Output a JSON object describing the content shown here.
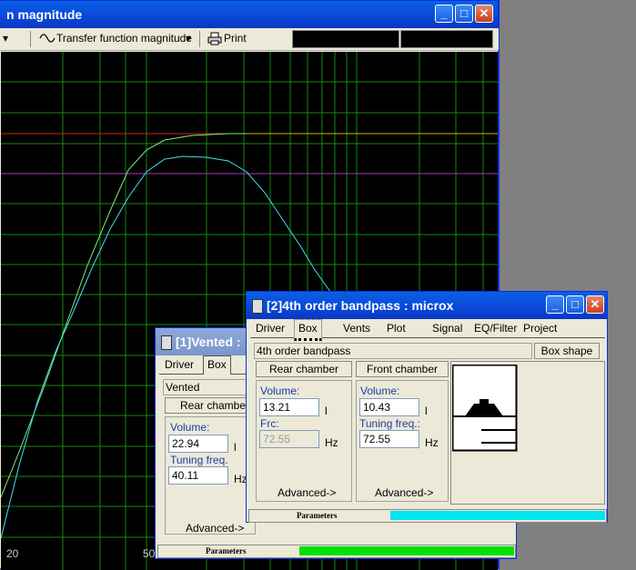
{
  "back_window": {
    "title": "n magnitude",
    "toolbar": {
      "dropdown_arrow": "▾",
      "transfer_label": "Transfer function magnitude",
      "print_label": "Print"
    },
    "chart_bottom_labels": [
      "20",
      "50"
    ]
  },
  "vented_window": {
    "title": "[1]Vented :",
    "tabs": [
      "Driver",
      "Box"
    ],
    "box_type": "Vented",
    "rear_chamber_label": "Rear chamber",
    "volume_label": "Volume:",
    "volume_value": "22.94",
    "volume_unit": "l",
    "tuning_label": "Tuning freq.",
    "tuning_value": "40.11",
    "tuning_unit": "Hz",
    "advanced_label": "Advanced->",
    "parameters_label": "Parameters",
    "status_color": "#00e000"
  },
  "bandpass_window": {
    "title": "[2]4th order bandpass : microx",
    "tabs": [
      "Driver",
      "Box",
      "Vents",
      "Plot",
      "Signal",
      "EQ/Filter",
      "Project"
    ],
    "box_type": "4th order bandpass",
    "box_shape_label": "Box shape",
    "rear_chamber_label": "Rear chamber",
    "front_chamber_label": "Front chamber",
    "rear": {
      "volume_label": "Volume:",
      "volume_value": "13.21",
      "volume_unit": "l",
      "frc_label": "Frc:",
      "frc_value": "72.55",
      "frc_unit": "Hz",
      "advanced_label": "Advanced->"
    },
    "front": {
      "volume_label": "Volume:",
      "volume_value": "10.43",
      "volume_unit": "l",
      "tuning_label": "Tuning freq.:",
      "tuning_value": "72.55",
      "tuning_unit": "Hz",
      "advanced_label": "Advanced->"
    },
    "parameters_label": "Parameters",
    "status_color": "#00e5ee"
  },
  "title_buttons": {
    "minimize": "_",
    "maximize": "□",
    "close": "✕"
  }
}
